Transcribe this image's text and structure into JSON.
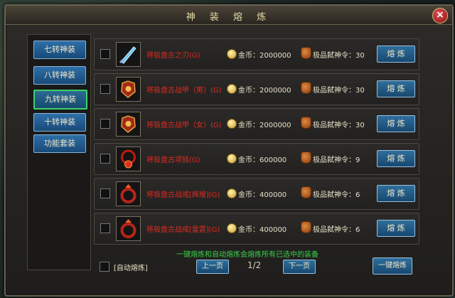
{
  "window": {
    "title": "神 装 熔 炼",
    "close_label": "×"
  },
  "sidebar": {
    "items": [
      {
        "label": "七转神装"
      },
      {
        "label": "八转神装"
      },
      {
        "label": "九转神装"
      },
      {
        "label": "十转神装"
      },
      {
        "label": "功能套装"
      }
    ],
    "active_index": 2
  },
  "rows": [
    {
      "name": "将极盘古之刃(G)",
      "gold": "金币：2000000",
      "material": "极品弑神令：30",
      "button": "熔 炼",
      "icon": "blue-blade-icon"
    },
    {
      "name": "将极盘古战甲（男）(G)",
      "gold": "金币：2000000",
      "material": "极品弑神令：30",
      "button": "熔 炼",
      "icon": "red-armor-icon"
    },
    {
      "name": "将极盘古战甲（女）(G)",
      "gold": "金币：2000000",
      "material": "极品弑神令：30",
      "button": "熔 炼",
      "icon": "red-armor-icon"
    },
    {
      "name": "将极盘古项链(G)",
      "gold": "金币：600000",
      "material": "极品弑神令：9",
      "button": "熔 炼",
      "icon": "red-necklace-icon"
    },
    {
      "name": "将极盘古战戒[辉煌](G)",
      "gold": "金币：400000",
      "material": "极品弑神令：6",
      "button": "熔 炼",
      "icon": "red-ring-icon"
    },
    {
      "name": "将极盘古战戒[雷霆](G)",
      "gold": "金币：400000",
      "material": "极品弑神令：6",
      "button": "熔 炼",
      "icon": "red-ring-icon"
    }
  ],
  "notice": "一键熔炼和自动熔炼会熔炼所有已选中的装备",
  "footer": {
    "auto_label": "[自动熔炼]",
    "prev_label": "上一页",
    "page": "1/2",
    "next_label": "下一页",
    "all_label": "一键熔炼"
  },
  "colors": {
    "item_name": "#e02a20",
    "notice": "#3ad04a",
    "button": "#2f6e9c",
    "active_border": "#3cd26a"
  }
}
